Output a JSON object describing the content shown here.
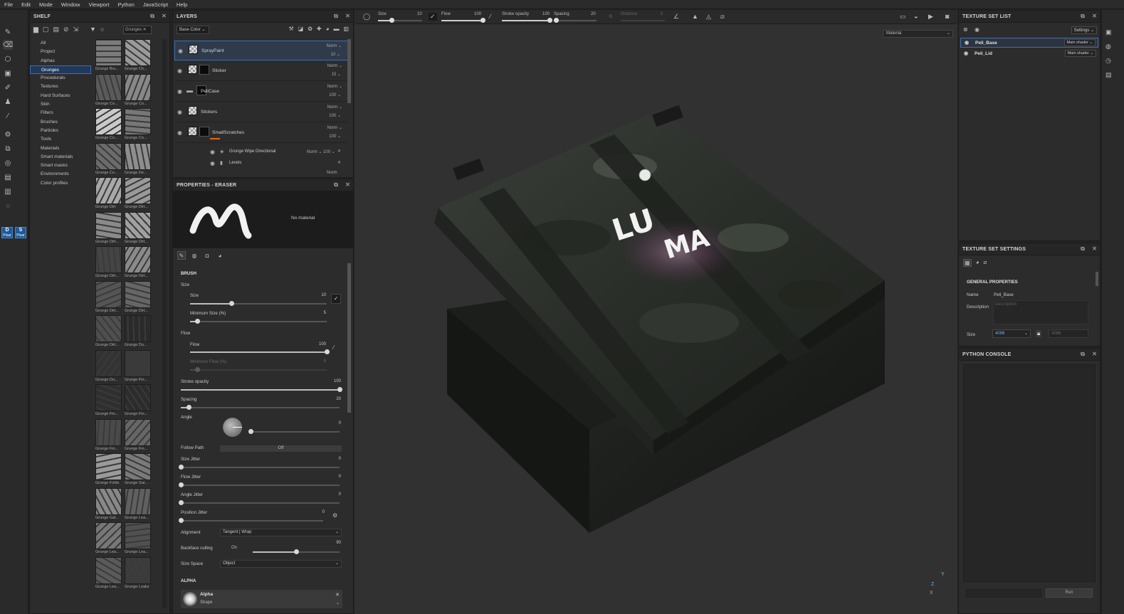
{
  "menu": [
    "File",
    "Edit",
    "Mode",
    "Window",
    "Viewport",
    "Python",
    "JavaScript",
    "Help"
  ],
  "shelf": {
    "title": "SHELF",
    "search_value": "Grunges",
    "categories": [
      "All",
      "Project",
      "Alphas",
      "Grunges",
      "Procedurals",
      "Textures",
      "Hard Surfaces",
      "Skin",
      "Filters",
      "Brushes",
      "Particles",
      "Tools",
      "Materials",
      "Smart materials",
      "Smart masks",
      "Environments",
      "Color profiles"
    ],
    "selected_category": "Grunges",
    "thumbs": [
      "Grunge Bru...",
      "Grunge Ch...",
      "Grunge Co...",
      "Grunge Co...",
      "Grunge Co...",
      "Grunge Co...",
      "Grunge Co...",
      "Grunge De...",
      "Grunge Dirt",
      "Grunge Dirt...",
      "Grunge Dirt...",
      "Grunge Dirt...",
      "Grunge Dirt...",
      "Grunge Dirt...",
      "Grunge Dirt...",
      "Grunge Dirt...",
      "Grunge Dirt...",
      "Grunge Du...",
      "Grunge Du...",
      "Grunge Fin...",
      "Grunge Fin...",
      "Grunge Fin...",
      "Grunge Fin...",
      "Grunge Fin...",
      "Grunge Folds",
      "Grunge Gal...",
      "Grunge Gal...",
      "Grunge Lea...",
      "Grunge Lea...",
      "Grunge Lea...",
      "Grunge Lea...",
      "Grunge Leaks"
    ]
  },
  "layers": {
    "title": "LAYERS",
    "channel": "Base Color",
    "rows": [
      {
        "name": "SprayPaint",
        "blend": "Norm",
        "opacity": "10"
      },
      {
        "name": "Sticker",
        "blend": "Norm",
        "opacity": "15"
      },
      {
        "name": "PeliCase",
        "blend": "Norm",
        "opacity": "100"
      },
      {
        "name": "Stickers",
        "blend": "Norm",
        "opacity": "100"
      },
      {
        "name": "SmallScratches",
        "blend": "Norm",
        "opacity": "100"
      }
    ],
    "sub_rows": [
      {
        "name": "Grunge Wipe Directional",
        "blend": "Norm",
        "opacity": "100"
      },
      {
        "name": "Levels"
      }
    ],
    "last_blend": "Norm"
  },
  "properties": {
    "title": "PROPERTIES - ERASER",
    "no_material": "No material",
    "brush_section": "BRUSH",
    "size_group": "Size",
    "size_label": "Size",
    "size_value": "10",
    "size_pos": 0.3,
    "min_size_label": "Minimum Size (%)",
    "min_size_value": "5",
    "min_size_pos": 0.05,
    "flow_group": "Flow",
    "flow_label": "Flow",
    "flow_value": "100",
    "flow_pos": 1.0,
    "min_flow_label": "Minimum Flow (%)",
    "min_flow_value": "5",
    "min_flow_pos": 0.05,
    "stroke_opacity_label": "Stroke opacity",
    "stroke_opacity_value": "100",
    "stroke_opacity_pos": 1.0,
    "spacing_label": "Spacing",
    "spacing_value": "20",
    "spacing_pos": 0.05,
    "angle_label": "Angle",
    "angle_value": "0",
    "follow_path_label": "Follow Path",
    "follow_path_value": "Off",
    "size_jitter_label": "Size Jitter",
    "size_jitter_value": "0",
    "flow_jitter_label": "Flow Jitter",
    "flow_jitter_value": "0",
    "angle_jitter_label": "Angle Jitter",
    "angle_jitter_value": "0",
    "position_jitter_label": "Position Jitter",
    "position_jitter_value": "0",
    "alignment_label": "Alignment",
    "alignment_value": "Tangent | Wrap",
    "backface_label": "Backface culling",
    "backface_toggle": "On",
    "backface_value": "90",
    "backface_pos": 0.5,
    "size_space_label": "Size Space",
    "size_space_value": "Object",
    "alpha_section": "ALPHA",
    "alpha_name": "Alpha",
    "alpha_sub": "Shape"
  },
  "viewport": {
    "size_label": "Size",
    "size_value": "10",
    "size_pos": 0.3,
    "flow_label": "Flow",
    "flow_value": "100",
    "flow_pos": 1.0,
    "stroke_opacity_label": "Stroke opacity",
    "stroke_opacity_value": "100",
    "stroke_opacity_pos": 1.0,
    "spacing_label": "Spacing",
    "spacing_value": "20",
    "spacing_pos": 0.05,
    "distance_label": "Distance",
    "distance_value": "0",
    "material_mode": "Material",
    "decal_text_1": "LU",
    "decal_text_2": "MA",
    "axis_y": "Y",
    "axis_z": "Z",
    "axis_x": "X"
  },
  "texture_set_list": {
    "title": "TEXTURE SET LIST",
    "settings": "Settings",
    "rows": [
      {
        "name": "Peli_Base",
        "shader": "Main shader"
      },
      {
        "name": "Peli_Lid",
        "shader": "Main shader"
      }
    ]
  },
  "texture_set_settings": {
    "title": "TEXTURE SET SETTINGS",
    "general": "GENERAL PROPERTIES",
    "name_label": "Name",
    "name_value": "Peli_Base",
    "description_label": "Description",
    "description_placeholder": "Description",
    "size_label": "Size",
    "size_value": "4096",
    "size_value_2": "4096"
  },
  "python_console": {
    "title": "PYTHON CONSOLE",
    "run": "Run"
  },
  "badges": [
    {
      "top": "D",
      "bottom": "Pixar"
    },
    {
      "top": "S",
      "bottom": "Pixar"
    }
  ]
}
